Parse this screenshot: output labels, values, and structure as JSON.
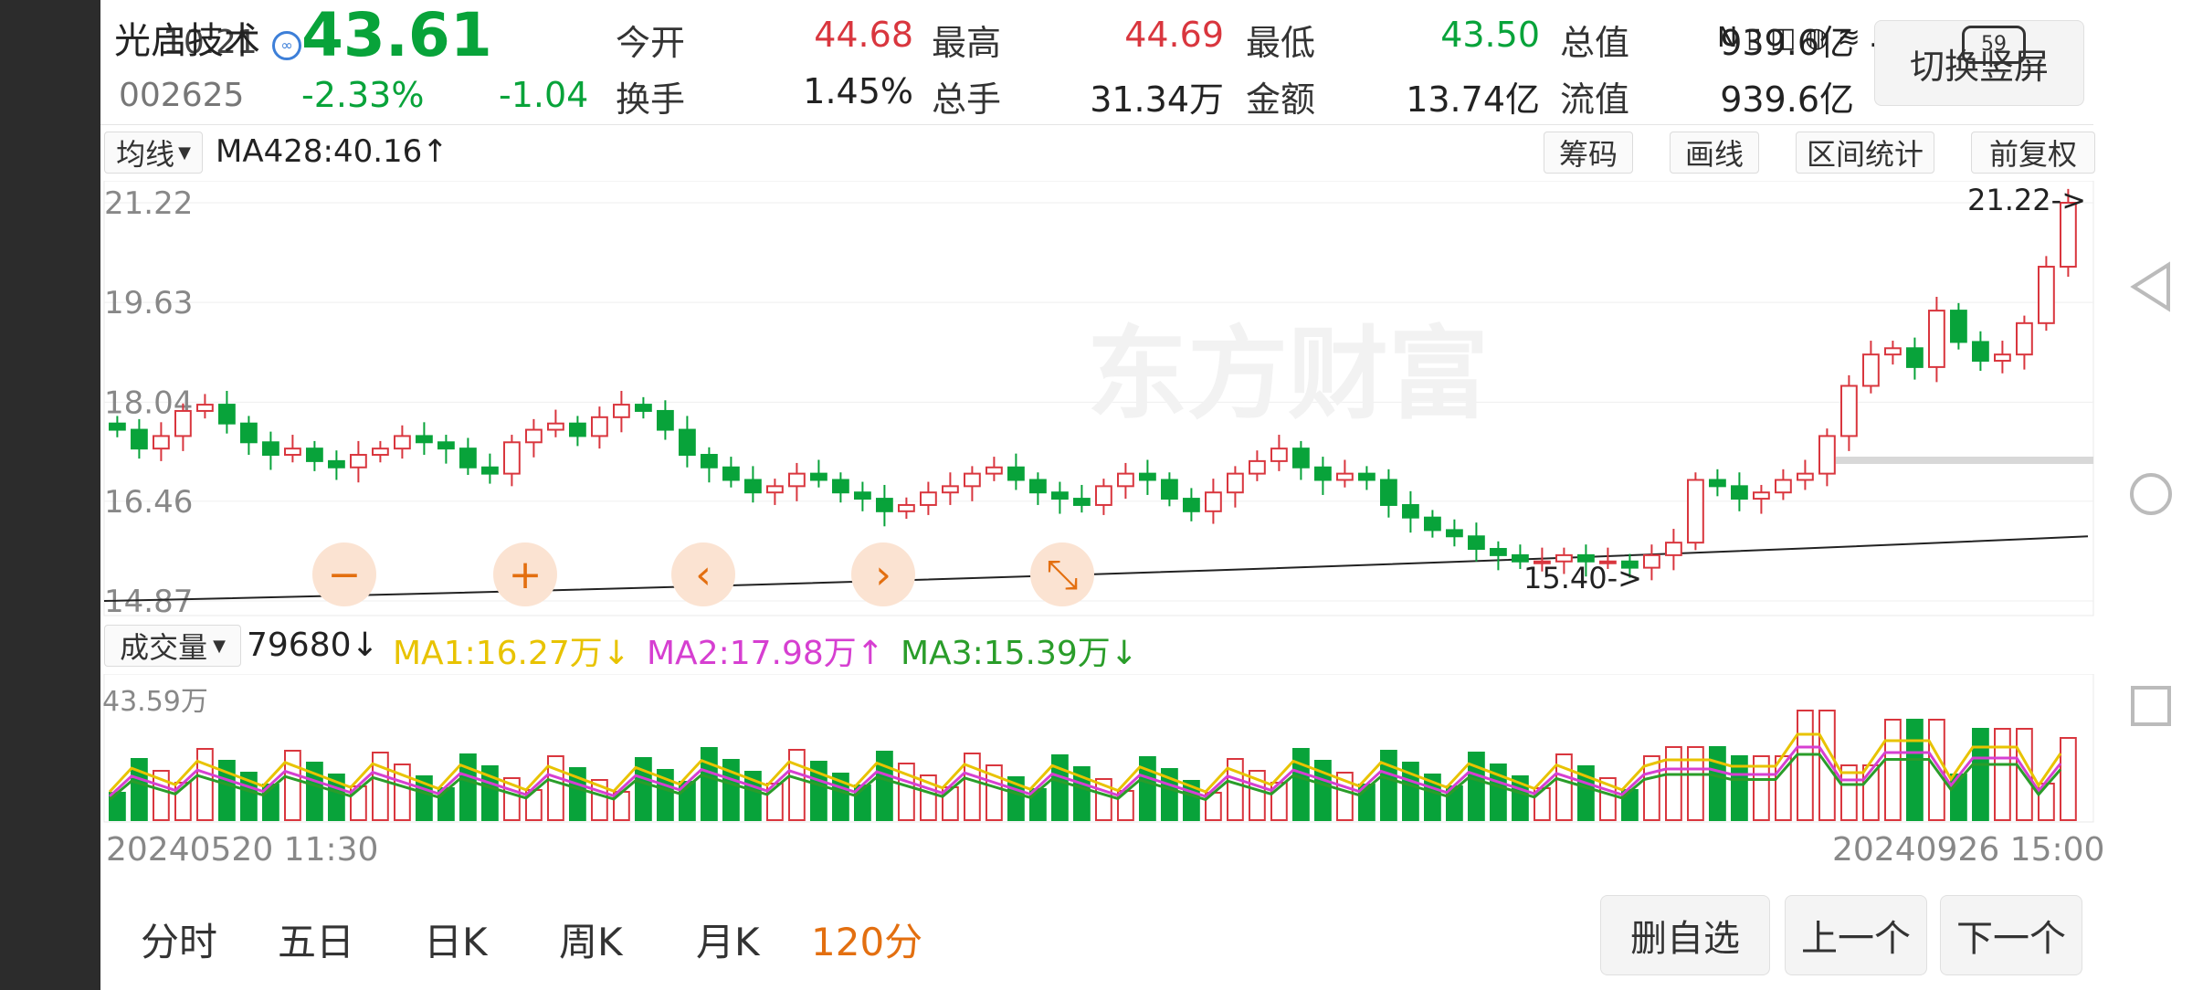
{
  "status_bar": {
    "time": "10:21",
    "icons": "N ▯ ◫ ◍ ≋ .ıl",
    "battery": "59"
  },
  "quote": {
    "name": "光启技术",
    "code": "002625",
    "price": "43.61",
    "change_pct": "-2.33%",
    "change": "-1.04",
    "fields": [
      {
        "label": "今开",
        "value": "44.68",
        "color": "#d9363e"
      },
      {
        "label": "最高",
        "value": "44.69",
        "color": "#d9363e"
      },
      {
        "label": "最低",
        "value": "43.50",
        "color": "#08a33a"
      },
      {
        "label": "总值",
        "value": "939.6亿",
        "color": "#222222"
      },
      {
        "label": "换手",
        "value": "1.45%",
        "color": "#222222"
      },
      {
        "label": "总手",
        "value": "31.34万",
        "color": "#222222"
      },
      {
        "label": "金额",
        "value": "13.74亿",
        "color": "#222222"
      },
      {
        "label": "流值",
        "value": "939.6亿",
        "color": "#222222"
      }
    ]
  },
  "switch_button": "切换竖屏",
  "toolbar": {
    "indicator": "均线",
    "ma_text": "MA428:40.16↑",
    "buttons": [
      "筹码",
      "画线",
      "区间统计",
      "前复权"
    ]
  },
  "price_axis": [
    "21.22",
    "19.63",
    "18.04",
    "16.46",
    "14.87"
  ],
  "watermark": "东方财富",
  "markers": {
    "high": "21.22->",
    "low": "15.40->"
  },
  "zoom_controls": [
    "zoom-out-icon",
    "zoom-in-icon",
    "pan-left-icon",
    "pan-right-icon",
    "reset-icon"
  ],
  "volume_bar": {
    "selector": "成交量",
    "value": "79680↓",
    "ma1": "MA1:16.27万↓",
    "ma2": "MA2:17.98万↑",
    "ma3": "MA3:15.39万↓",
    "max": "43.59万",
    "colors": {
      "ma1": "#e8c300",
      "ma2": "#d63fd1",
      "ma3": "#2a9d2a"
    }
  },
  "dates": {
    "start": "20240520 11:30",
    "end": "20240926 15:00"
  },
  "tabs": [
    {
      "label": "分时",
      "active": false
    },
    {
      "label": "五日",
      "active": false
    },
    {
      "label": "日K",
      "active": false
    },
    {
      "label": "周K",
      "active": false
    },
    {
      "label": "月K",
      "active": false
    },
    {
      "label": "120分",
      "active": true
    }
  ],
  "bottom_buttons": [
    "删自选",
    "上一个",
    "下一个"
  ],
  "colors": {
    "up": "#d9363e",
    "down": "#08a33a",
    "accent": "#e36f10"
  },
  "chart_data": {
    "type": "candlestick",
    "ylim": [
      14.87,
      21.22
    ],
    "closes": [
      17.6,
      17.3,
      17.5,
      17.9,
      18.0,
      17.7,
      17.4,
      17.2,
      17.3,
      17.1,
      17.0,
      17.2,
      17.3,
      17.5,
      17.4,
      17.3,
      17.0,
      16.9,
      17.4,
      17.6,
      17.7,
      17.5,
      17.8,
      18.0,
      17.9,
      17.6,
      17.2,
      17.0,
      16.8,
      16.6,
      16.7,
      16.9,
      16.8,
      16.6,
      16.5,
      16.3,
      16.4,
      16.6,
      16.7,
      16.9,
      17.0,
      16.8,
      16.6,
      16.5,
      16.4,
      16.7,
      16.9,
      16.8,
      16.5,
      16.3,
      16.6,
      16.9,
      17.1,
      17.3,
      17.0,
      16.8,
      16.9,
      16.8,
      16.4,
      16.2,
      16.0,
      15.9,
      15.7,
      15.6,
      15.5,
      15.5,
      15.6,
      15.5,
      15.5,
      15.4,
      15.6,
      15.8,
      16.8,
      16.7,
      16.5,
      16.6,
      16.8,
      16.9,
      17.5,
      18.3,
      18.8,
      18.9,
      18.6,
      19.5,
      19.0,
      18.7,
      18.8,
      19.3,
      20.2,
      21.22
    ],
    "volume_max": "43.59万"
  }
}
